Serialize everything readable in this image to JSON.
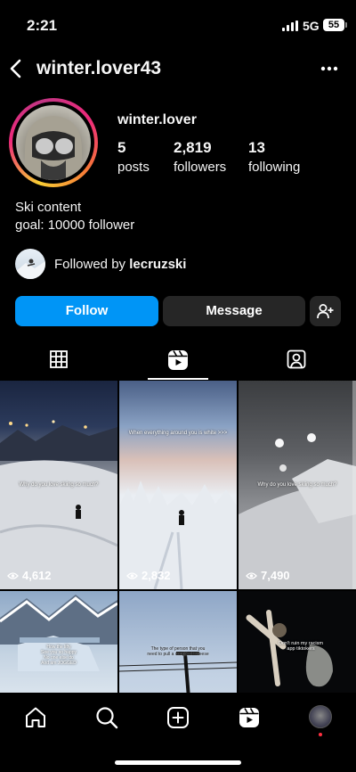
{
  "status": {
    "time": "2:21",
    "network": "5G",
    "battery": "55"
  },
  "header": {
    "username": "winter.lover43",
    "back_icon": "chevron-left-icon",
    "more_icon": "ellipsis-icon"
  },
  "profile": {
    "display_name": "winter.lover",
    "stats": [
      {
        "value": "5",
        "label": "posts"
      },
      {
        "value": "2,819",
        "label": "followers"
      },
      {
        "value": "13",
        "label": "following"
      }
    ],
    "bio_lines": [
      "Ski content",
      "goal: 10000 follower"
    ],
    "followed_by_prefix": "Followed by",
    "followed_by_user": "lecruzski"
  },
  "actions": {
    "follow": "Follow",
    "message": "Message",
    "add_user_icon": "person-add-icon"
  },
  "tabs": [
    {
      "name": "grid-icon",
      "active": false
    },
    {
      "name": "reels-icon",
      "active": true
    },
    {
      "name": "tagged-icon",
      "active": false
    }
  ],
  "reels": [
    {
      "caption": "Why do you love skiing so much?",
      "views": "4,612"
    },
    {
      "caption": "When everything around you is white >>>",
      "views": "2,832"
    },
    {
      "caption": "Why do you love skiing so much?",
      "views": "7,490"
    },
    {
      "caption": "How the lifty\nSee you so happy\nNo one else do\nAnd am JOGGED"
    },
    {
      "caption": "The type of person that you\nneed to pull a couple of cheese"
    },
    {
      "caption": "Don't ruin my racism\napp tiktokers"
    }
  ],
  "bottom_nav": [
    "home-icon",
    "search-icon",
    "create-icon",
    "reels-icon",
    "profile-icon"
  ],
  "colors": {
    "accent": "#0095f6",
    "button_dark": "#262626",
    "background": "#000000"
  }
}
